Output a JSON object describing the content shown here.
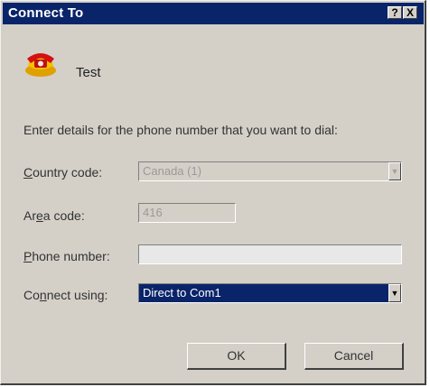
{
  "window": {
    "title": "Connect To",
    "help_glyph": "?",
    "close_glyph": "X"
  },
  "connection": {
    "name": "Test"
  },
  "form": {
    "instructions": "Enter details for the phone number that you want to dial:",
    "country_code": {
      "label_prefix": "",
      "label_underlined": "C",
      "label_suffix": "ountry code:",
      "value": "Canada (1)"
    },
    "area_code": {
      "label_prefix": "Ar",
      "label_underlined": "e",
      "label_suffix": "a code:",
      "value": "416"
    },
    "phone_number": {
      "label_prefix": "",
      "label_underlined": "P",
      "label_suffix": "hone number:",
      "value": ""
    },
    "connect_using": {
      "label_prefix": "Co",
      "label_underlined": "n",
      "label_suffix": "nect using:",
      "value": "Direct to Com1"
    }
  },
  "buttons": {
    "ok_label": "OK",
    "cancel_label": "Cancel"
  },
  "colors": {
    "titlebar": "#0a246a",
    "face": "#d4d0c8",
    "selection": "#0a246a"
  },
  "icons": {
    "connection_icon": "red-telephone-icon"
  }
}
